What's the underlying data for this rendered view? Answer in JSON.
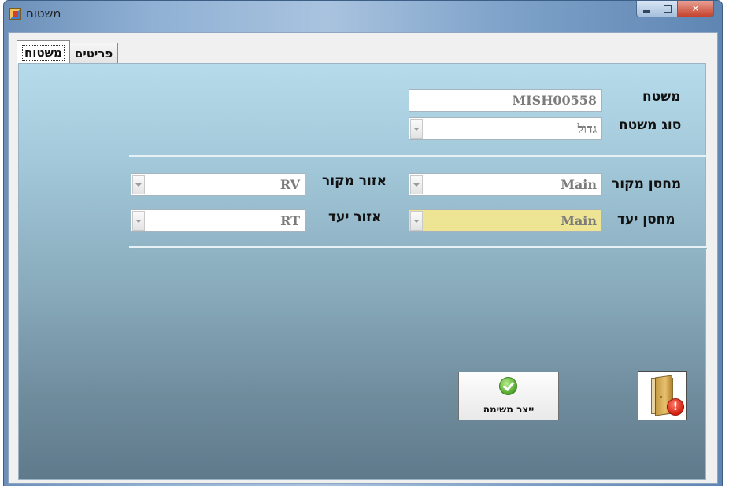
{
  "window": {
    "title": "משטוח",
    "min_glyph": "",
    "max_glyph": "",
    "close_glyph": "✕"
  },
  "tabs": [
    {
      "label": "משטוח",
      "active": true
    },
    {
      "label": "פריטים",
      "active": false
    }
  ],
  "form": {
    "pallet_label": "משטח",
    "pallet_value": "MISH00558",
    "pallet_type_label": "סוג משטח",
    "pallet_type_value": "גדול",
    "source_warehouse_label": "מחסן מקור",
    "source_warehouse_value": "Main",
    "source_area_label": "אזור מקור",
    "source_area_value": "RV",
    "target_warehouse_label": "מחסן יעד",
    "target_warehouse_value": "Main",
    "target_area_label": "אזור יעד",
    "target_area_value": "RT"
  },
  "buttons": {
    "create_list_label": "ייצר משימה",
    "exit_badge": "!"
  },
  "icons": {
    "create_list": "green-check-icon",
    "exit": "exit-door-icon"
  },
  "colors": {
    "highlight_field": "#ede594",
    "panel_top": "#b6dcec",
    "panel_bottom": "#5f7a8b"
  }
}
